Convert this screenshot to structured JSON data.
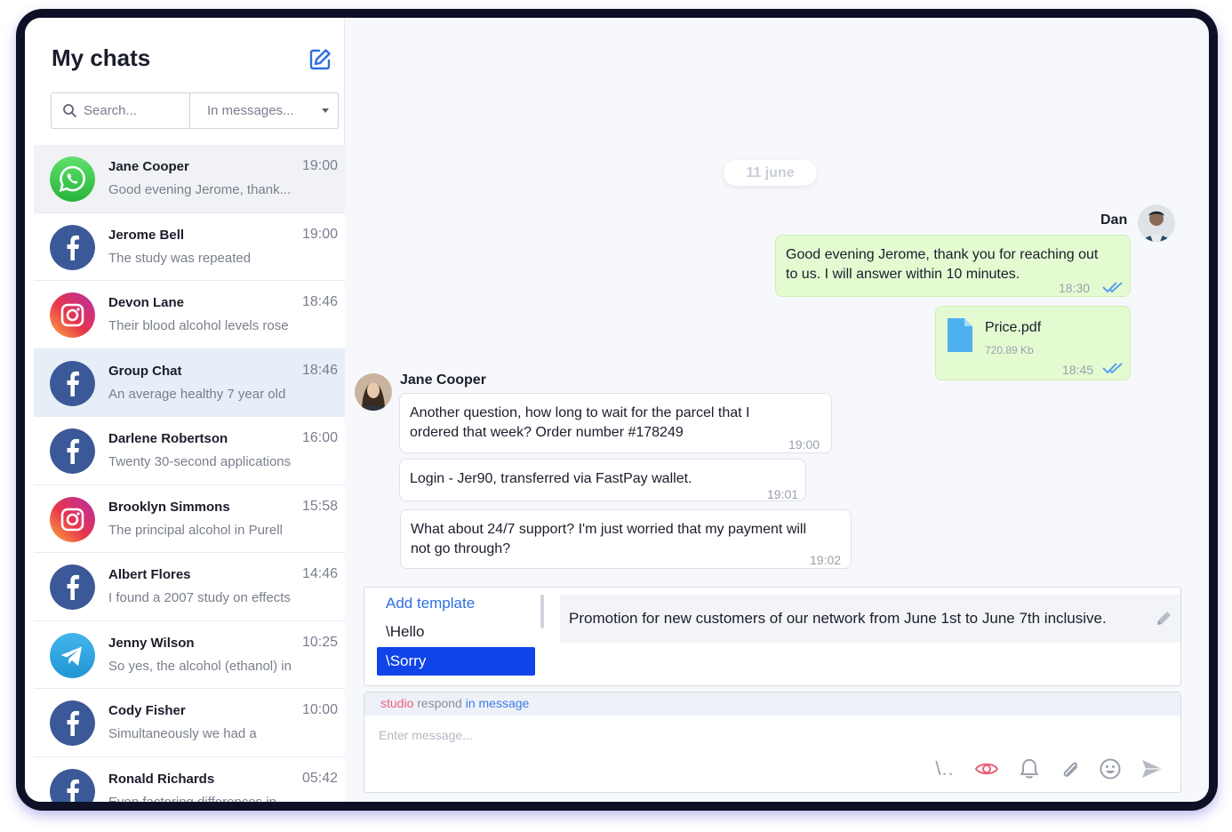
{
  "sidebar": {
    "title": "My chats",
    "search": {
      "placeholder": "Search..."
    },
    "filter": {
      "selected": "In messages..."
    }
  },
  "chats": [
    {
      "name": "Jane Cooper",
      "time": "19:00",
      "preview": "Good evening Jerome, thank...",
      "channel": "whatsapp-icon"
    },
    {
      "name": "Jerome Bell",
      "time": "19:00",
      "preview": "The study was repeated",
      "channel": "facebook-icon"
    },
    {
      "name": "Devon Lane",
      "time": "18:46",
      "preview": "Their blood alcohol levels rose",
      "channel": "instagram-icon"
    },
    {
      "name": "Group Chat",
      "time": "18:46",
      "preview": "An average healthy 7 year old",
      "channel": "facebook-icon"
    },
    {
      "name": "Darlene Robertson",
      "time": "16:00",
      "preview": "Twenty 30-second applications",
      "channel": "facebook-icon"
    },
    {
      "name": "Brooklyn Simmons",
      "time": "15:58",
      "preview": "The principal alcohol in Purell",
      "channel": "instagram-icon"
    },
    {
      "name": "Albert Flores",
      "time": "14:46",
      "preview": "I found a 2007 study on effects",
      "channel": "facebook-icon"
    },
    {
      "name": "Jenny Wilson",
      "time": "10:25",
      "preview": "So yes, the alcohol (ethanol) in",
      "channel": "telegram-icon"
    },
    {
      "name": "Cody Fisher",
      "time": "10:00",
      "preview": "Simultaneously we had a",
      "channel": "facebook-icon"
    },
    {
      "name": "Ronald Richards",
      "time": "05:42",
      "preview": "Even factoring differences in",
      "channel": "facebook-icon"
    }
  ],
  "conversation": {
    "date": "11 june",
    "outgoing_sender": "Dan",
    "incoming_sender": "Jane Cooper",
    "out_msg1": {
      "line1": "Good evening Jerome, thank you for reaching out",
      "line2": "to us. I will answer within 10 minutes.",
      "time": "18:30"
    },
    "out_file": {
      "name": "Price.pdf",
      "size": "720.89 Kb",
      "time": "18:45"
    },
    "in_msg1": {
      "line1": "Another question, how long to wait for the parcel that I",
      "line2": "ordered that week? Order number #178249",
      "time": "19:00"
    },
    "in_msg2": {
      "line1": "Login - Jer90, transferred via FastPay wallet.",
      "time": "19:01"
    },
    "in_msg3": {
      "line1": "What about 24/7 support? I'm just worried that my payment will",
      "line2": "not go through?",
      "time": "19:02"
    }
  },
  "templates": {
    "add_label": "Add template",
    "items": [
      "\\Hello",
      "\\Sorry"
    ],
    "preview": "Promotion for new customers of our network from June 1st to June 7th inclusive."
  },
  "composer": {
    "hint_studio": "studio",
    "hint_respond": "respond",
    "hint_in": "in message",
    "placeholder": "Enter message...",
    "template_tool": "\\.."
  },
  "colors": {
    "accent": "#0f44e8",
    "outgoing_bubble": "#e4fbd2",
    "link": "#2e6fe0"
  }
}
